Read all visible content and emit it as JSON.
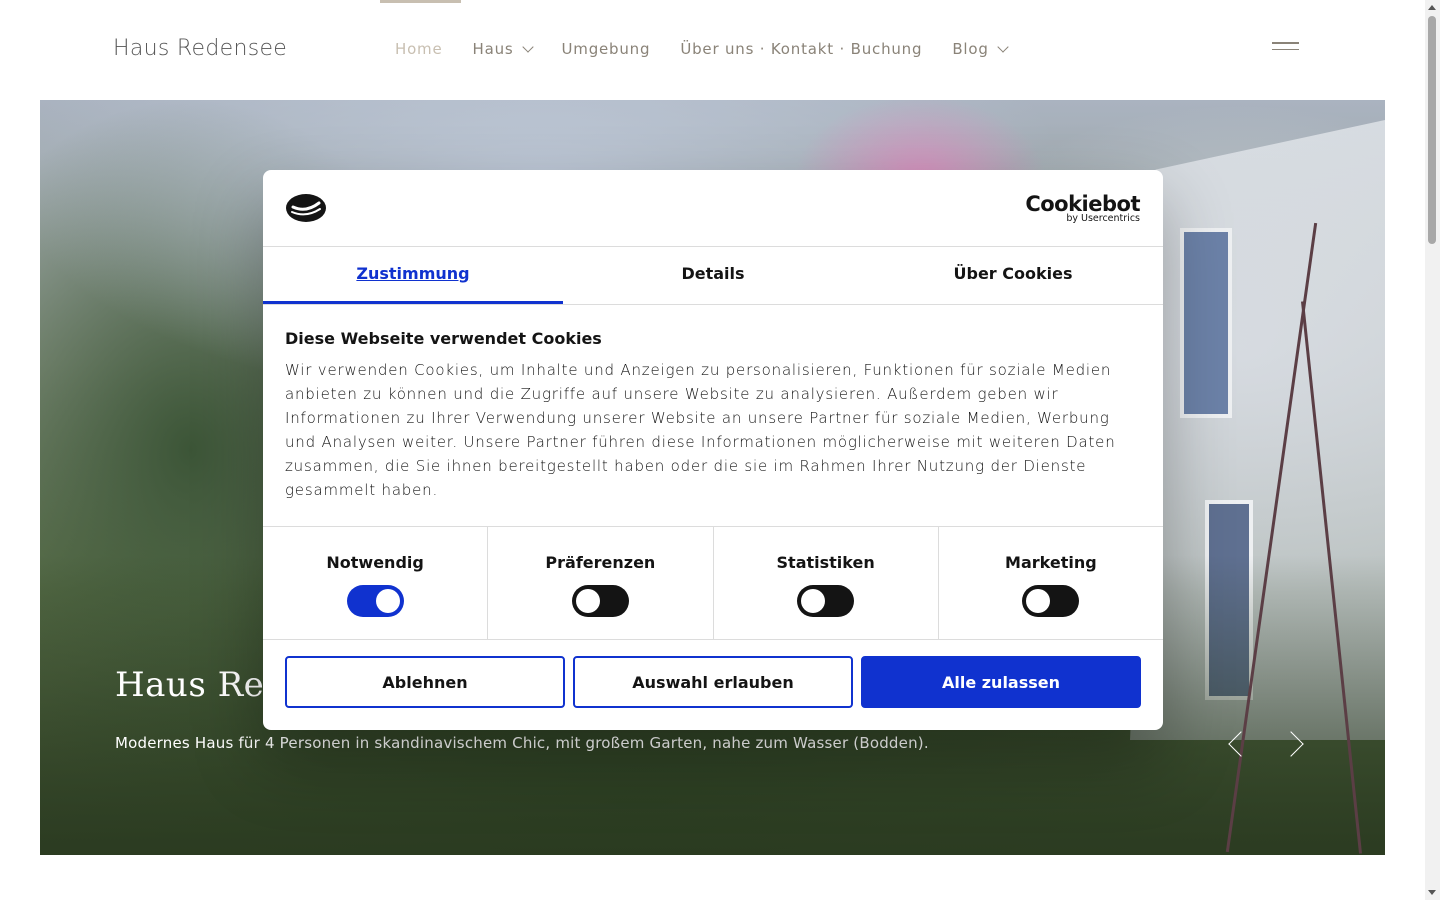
{
  "header": {
    "site_title": "Haus Redensee",
    "nav": [
      {
        "label": "Home",
        "active": true,
        "dropdown": false
      },
      {
        "label": "Haus",
        "active": false,
        "dropdown": true
      },
      {
        "label": "Umgebung",
        "active": false,
        "dropdown": false
      },
      {
        "label": "Über uns · Kontakt · Buchung",
        "active": false,
        "dropdown": false
      },
      {
        "label": "Blog",
        "active": false,
        "dropdown": true
      }
    ]
  },
  "hero": {
    "title": "Haus Redensee",
    "subtitle": "Modernes Haus für 4 Personen in skandinavischem Chic, mit großem Garten, nahe zum Wasser (Bodden)."
  },
  "cookie_dialog": {
    "brand_main": "Cookiebot",
    "brand_sub": "by Usercentrics",
    "tabs": [
      "Zustimmung",
      "Details",
      "Über Cookies"
    ],
    "title": "Diese Webseite verwendet Cookies",
    "text": "Wir verwenden Cookies, um Inhalte und Anzeigen zu personalisieren, Funktionen für soziale Medien anbieten zu können und die Zugriffe auf unsere Website zu analysieren. Außerdem geben wir Informationen zu Ihrer Verwendung unserer Website an unsere Partner für soziale Medien, Werbung und Analysen weiter. Unsere Partner führen diese Informationen möglicherweise mit weiteren Daten zusammen, die Sie ihnen bereitgestellt haben oder die sie im Rahmen Ihrer Nutzung der Dienste gesammelt haben.",
    "toggles": [
      {
        "label": "Notwendig",
        "on": true
      },
      {
        "label": "Präferenzen",
        "on": false
      },
      {
        "label": "Statistiken",
        "on": false
      },
      {
        "label": "Marketing",
        "on": false
      }
    ],
    "buttons": {
      "decline": "Ablehnen",
      "allow_selection": "Auswahl erlauben",
      "allow_all": "Alle zulassen"
    },
    "colors": {
      "accent": "#1032cf"
    }
  }
}
